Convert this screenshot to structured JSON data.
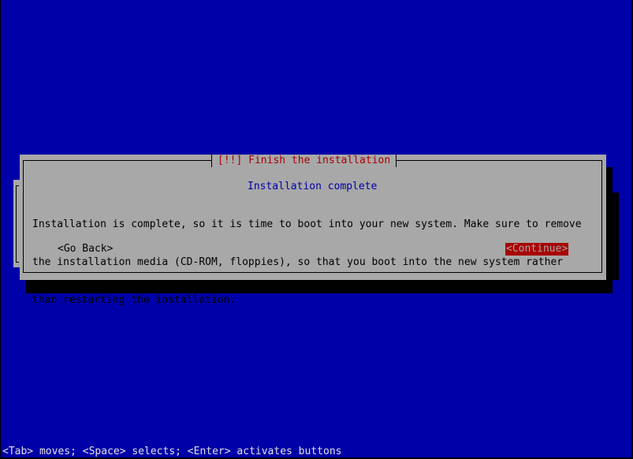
{
  "dialog": {
    "title": "[!!] Finish the installation",
    "subtitle": "Installation complete",
    "body_lines": [
      "Installation is complete, so it is time to boot into your new system. Make sure to remove",
      "the installation media (CD-ROM, floppies), so that you boot into the new system rather",
      "than restarting the installation."
    ],
    "buttons": {
      "go_back": "<Go Back>",
      "continue": "<Continue>"
    },
    "selected_button": "continue"
  },
  "status_line": "<Tab> moves; <Space> selects; <Enter> activates buttons",
  "colors": {
    "screen_background": "#0000a8",
    "dialog_background": "#a8a8a8",
    "title_text": "#a80000",
    "subtitle_text": "#0000a8",
    "selected_button_background": "#a80000",
    "shadow": "#000000"
  }
}
